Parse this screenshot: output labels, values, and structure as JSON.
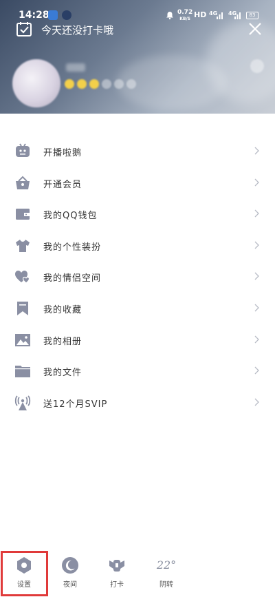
{
  "status_bar": {
    "time": "14:28",
    "net_speed_value": "0.72",
    "net_speed_unit": "KB/S",
    "hd": "HD",
    "signal1": "4G",
    "signal2": "4G",
    "battery": "83"
  },
  "header": {
    "checkin_text": "今天还没打卡哦"
  },
  "menu": {
    "items": [
      {
        "label": "开播啦鹅",
        "icon": "tv-robot-icon"
      },
      {
        "label": "开通会员",
        "icon": "crown-basket-icon"
      },
      {
        "label": "我的QQ钱包",
        "icon": "wallet-icon"
      },
      {
        "label": "我的个性装扮",
        "icon": "tshirt-icon"
      },
      {
        "label": "我的情侣空间",
        "icon": "hearts-icon"
      },
      {
        "label": "我的收藏",
        "icon": "bookmark-icon"
      },
      {
        "label": "我的相册",
        "icon": "photo-icon"
      },
      {
        "label": "我的文件",
        "icon": "folder-icon"
      },
      {
        "label": "送12个月SVIP",
        "icon": "broadcast-tower-icon"
      }
    ]
  },
  "bottom_bar": {
    "settings_label": "设置",
    "night_label": "夜间",
    "checkin_label": "打卡",
    "weather_temp": "22°",
    "weather_label": "阴转"
  },
  "colors": {
    "icon_gray": "#8a8fa3",
    "highlight_red": "#e03a3a"
  }
}
